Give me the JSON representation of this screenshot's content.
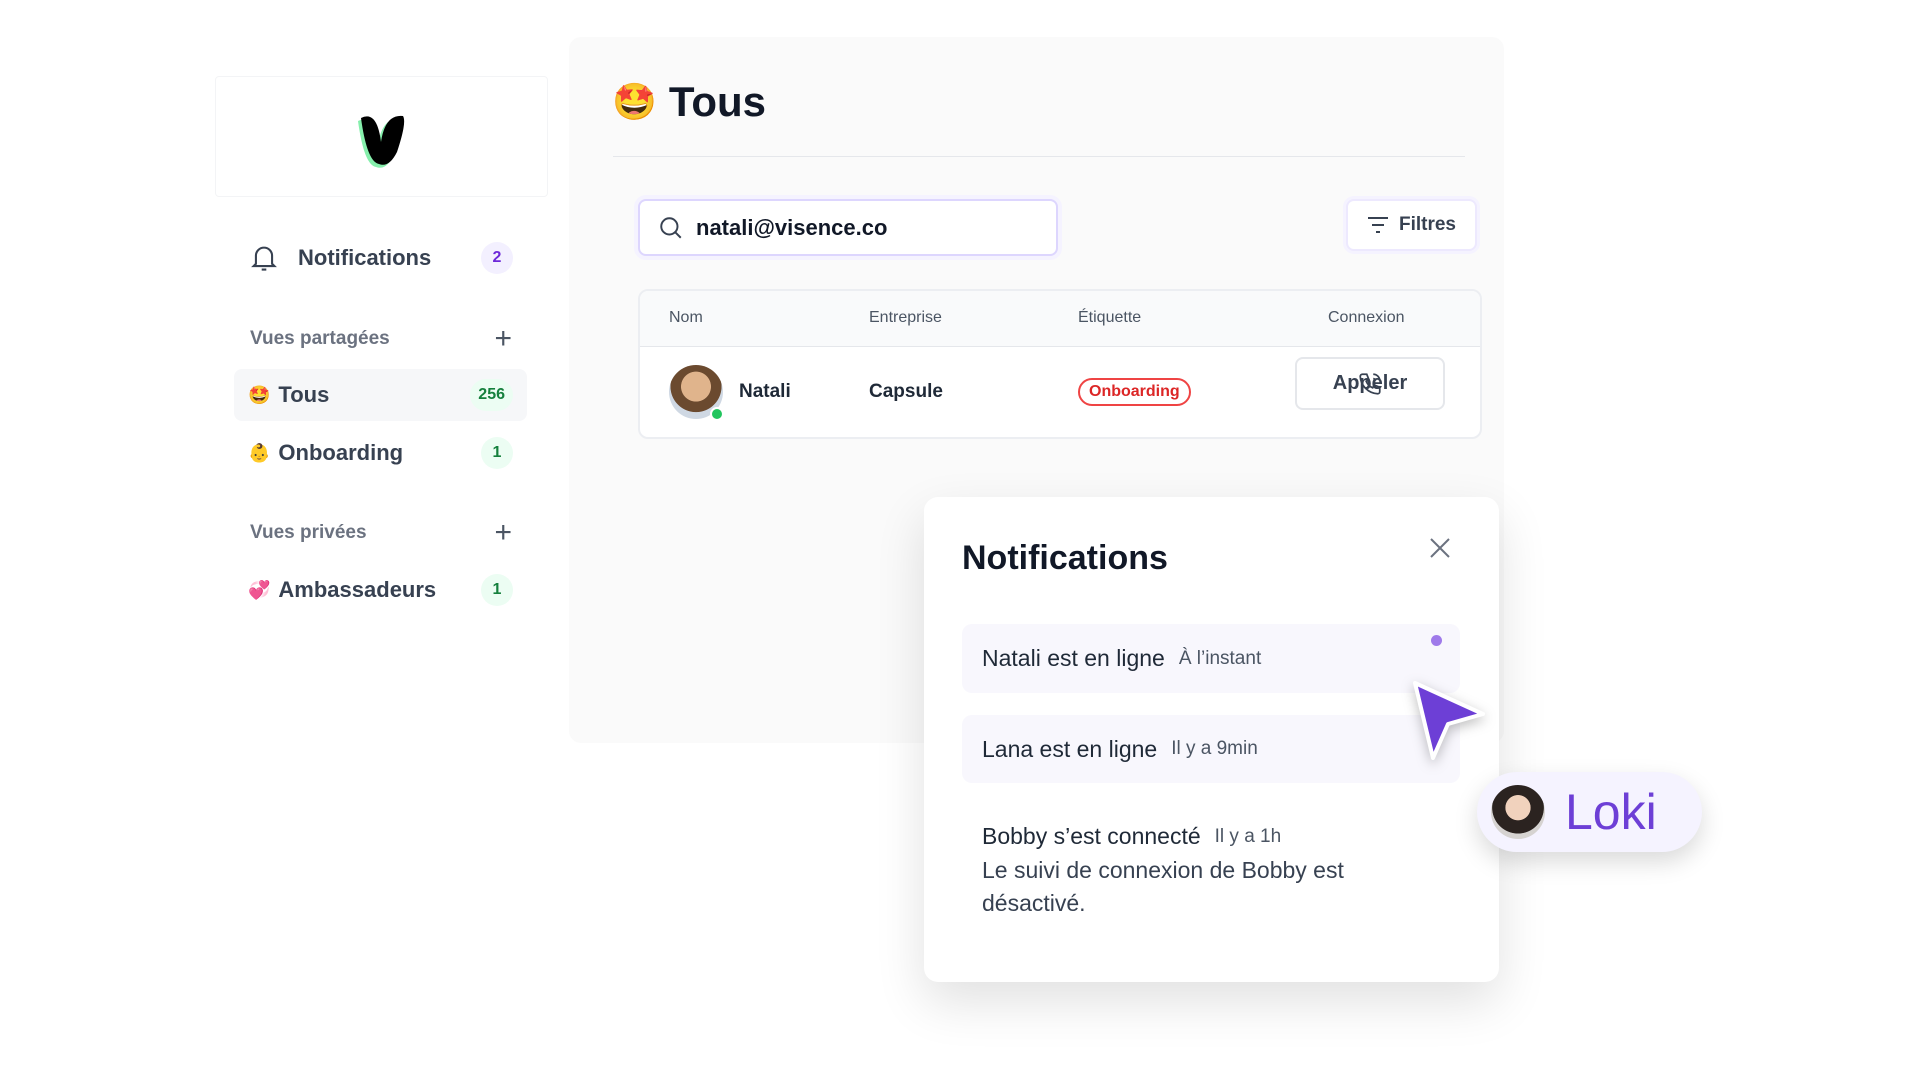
{
  "sidebar": {
    "logo_letter": "V",
    "notifications": {
      "label": "Notifications",
      "count": "2",
      "icon": "bell-icon"
    },
    "shared_views": {
      "label": "Vues partagées",
      "add": "+",
      "items": [
        {
          "emoji": "🤩",
          "label": "Tous",
          "count": "256",
          "active": true
        },
        {
          "emoji": "👶",
          "label": "Onboarding",
          "count": "1"
        }
      ]
    },
    "private_views": {
      "label": "Vues privées",
      "add": "+",
      "items": [
        {
          "emoji": "💞",
          "label": "Ambassadeurs",
          "count": "1"
        }
      ]
    }
  },
  "main": {
    "title_emoji": "🤩",
    "title": "Tous",
    "search": {
      "value": "natali@visence.co",
      "icon": "search-icon"
    },
    "filters_label": "Filtres",
    "table": {
      "columns": [
        "Nom",
        "Entreprise",
        "Étiquette",
        "Connexion"
      ],
      "rows": [
        {
          "name": "Natali",
          "company": "Capsule",
          "tag": "Onboarding",
          "action": "Appeler",
          "online": true
        }
      ]
    }
  },
  "notifications_panel": {
    "title": "Notifications",
    "items": [
      {
        "text": "Natali est en ligne",
        "time": "À l’instant",
        "unread": true
      },
      {
        "text": "Lana est en ligne",
        "time": "Il y a 9min"
      },
      {
        "text": "Bobby s’est connecté",
        "time": "Il y a 1h",
        "detail": "Le suivi de connexion de Bobby est désactivé."
      }
    ]
  },
  "cursor_user": {
    "name": "Loki"
  },
  "colors": {
    "accent": "#6d3fd6",
    "online": "#22c55e",
    "tag": "#ef4444"
  }
}
